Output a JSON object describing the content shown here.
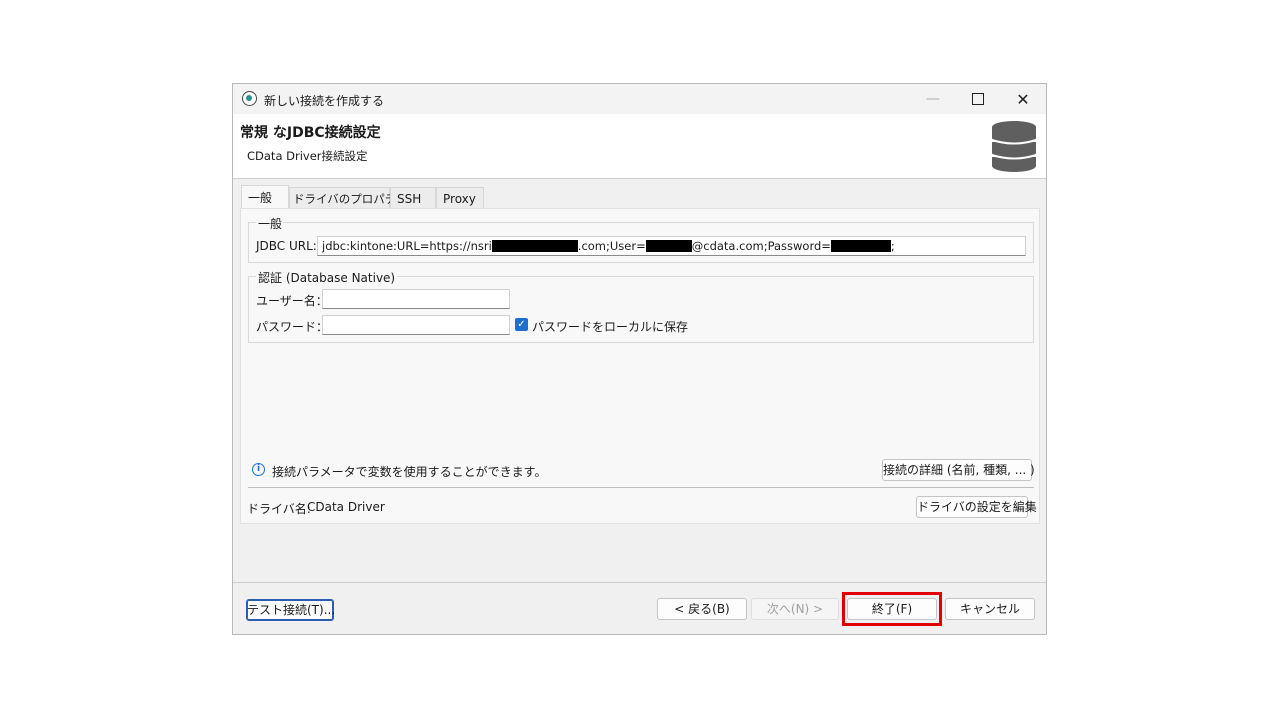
{
  "window": {
    "title": "新しい接続を作成する",
    "min_symbol": "—",
    "close_symbol": "✕"
  },
  "header": {
    "title": "常規 なJDBC接続設定",
    "subtitle": "CData Driver接続設定",
    "icon": "database-icon"
  },
  "tabs": [
    "一般",
    "ドライバのプロパティ",
    "SSH",
    "Proxy"
  ],
  "general_group": {
    "label": "一般",
    "jdbc_url_label": "JDBC URL:",
    "url_part1": "jdbc:kintone:URL=https://nsri",
    "url_part2": ".com;User=",
    "url_part3": "@cdata.com;Password=",
    "url_part4": ";"
  },
  "auth_group": {
    "label": "認証 (Database Native)",
    "username_label": "ユーザー名：",
    "username_value": "",
    "password_label": "パスワード：",
    "password_value": "",
    "save_password_label": "パスワードをローカルに保存",
    "save_password_checked": true
  },
  "info": {
    "text": "接続パラメータで変数を使用することができます。",
    "details_button": "接続の詳細 (名前, 種類, ... )"
  },
  "driver": {
    "label": "ドライバ名:",
    "name": "CData Driver",
    "edit_button": "ドライバの設定を編集"
  },
  "footer": {
    "test_button": "テスト接続(T)...",
    "back_button": "< 戻る(B)",
    "next_button": "次へ(N) >",
    "finish_button": "終了(F)",
    "cancel_button": "キャンセル"
  },
  "colors": {
    "accent": "#1f6fd1",
    "highlight": "#e00000"
  }
}
